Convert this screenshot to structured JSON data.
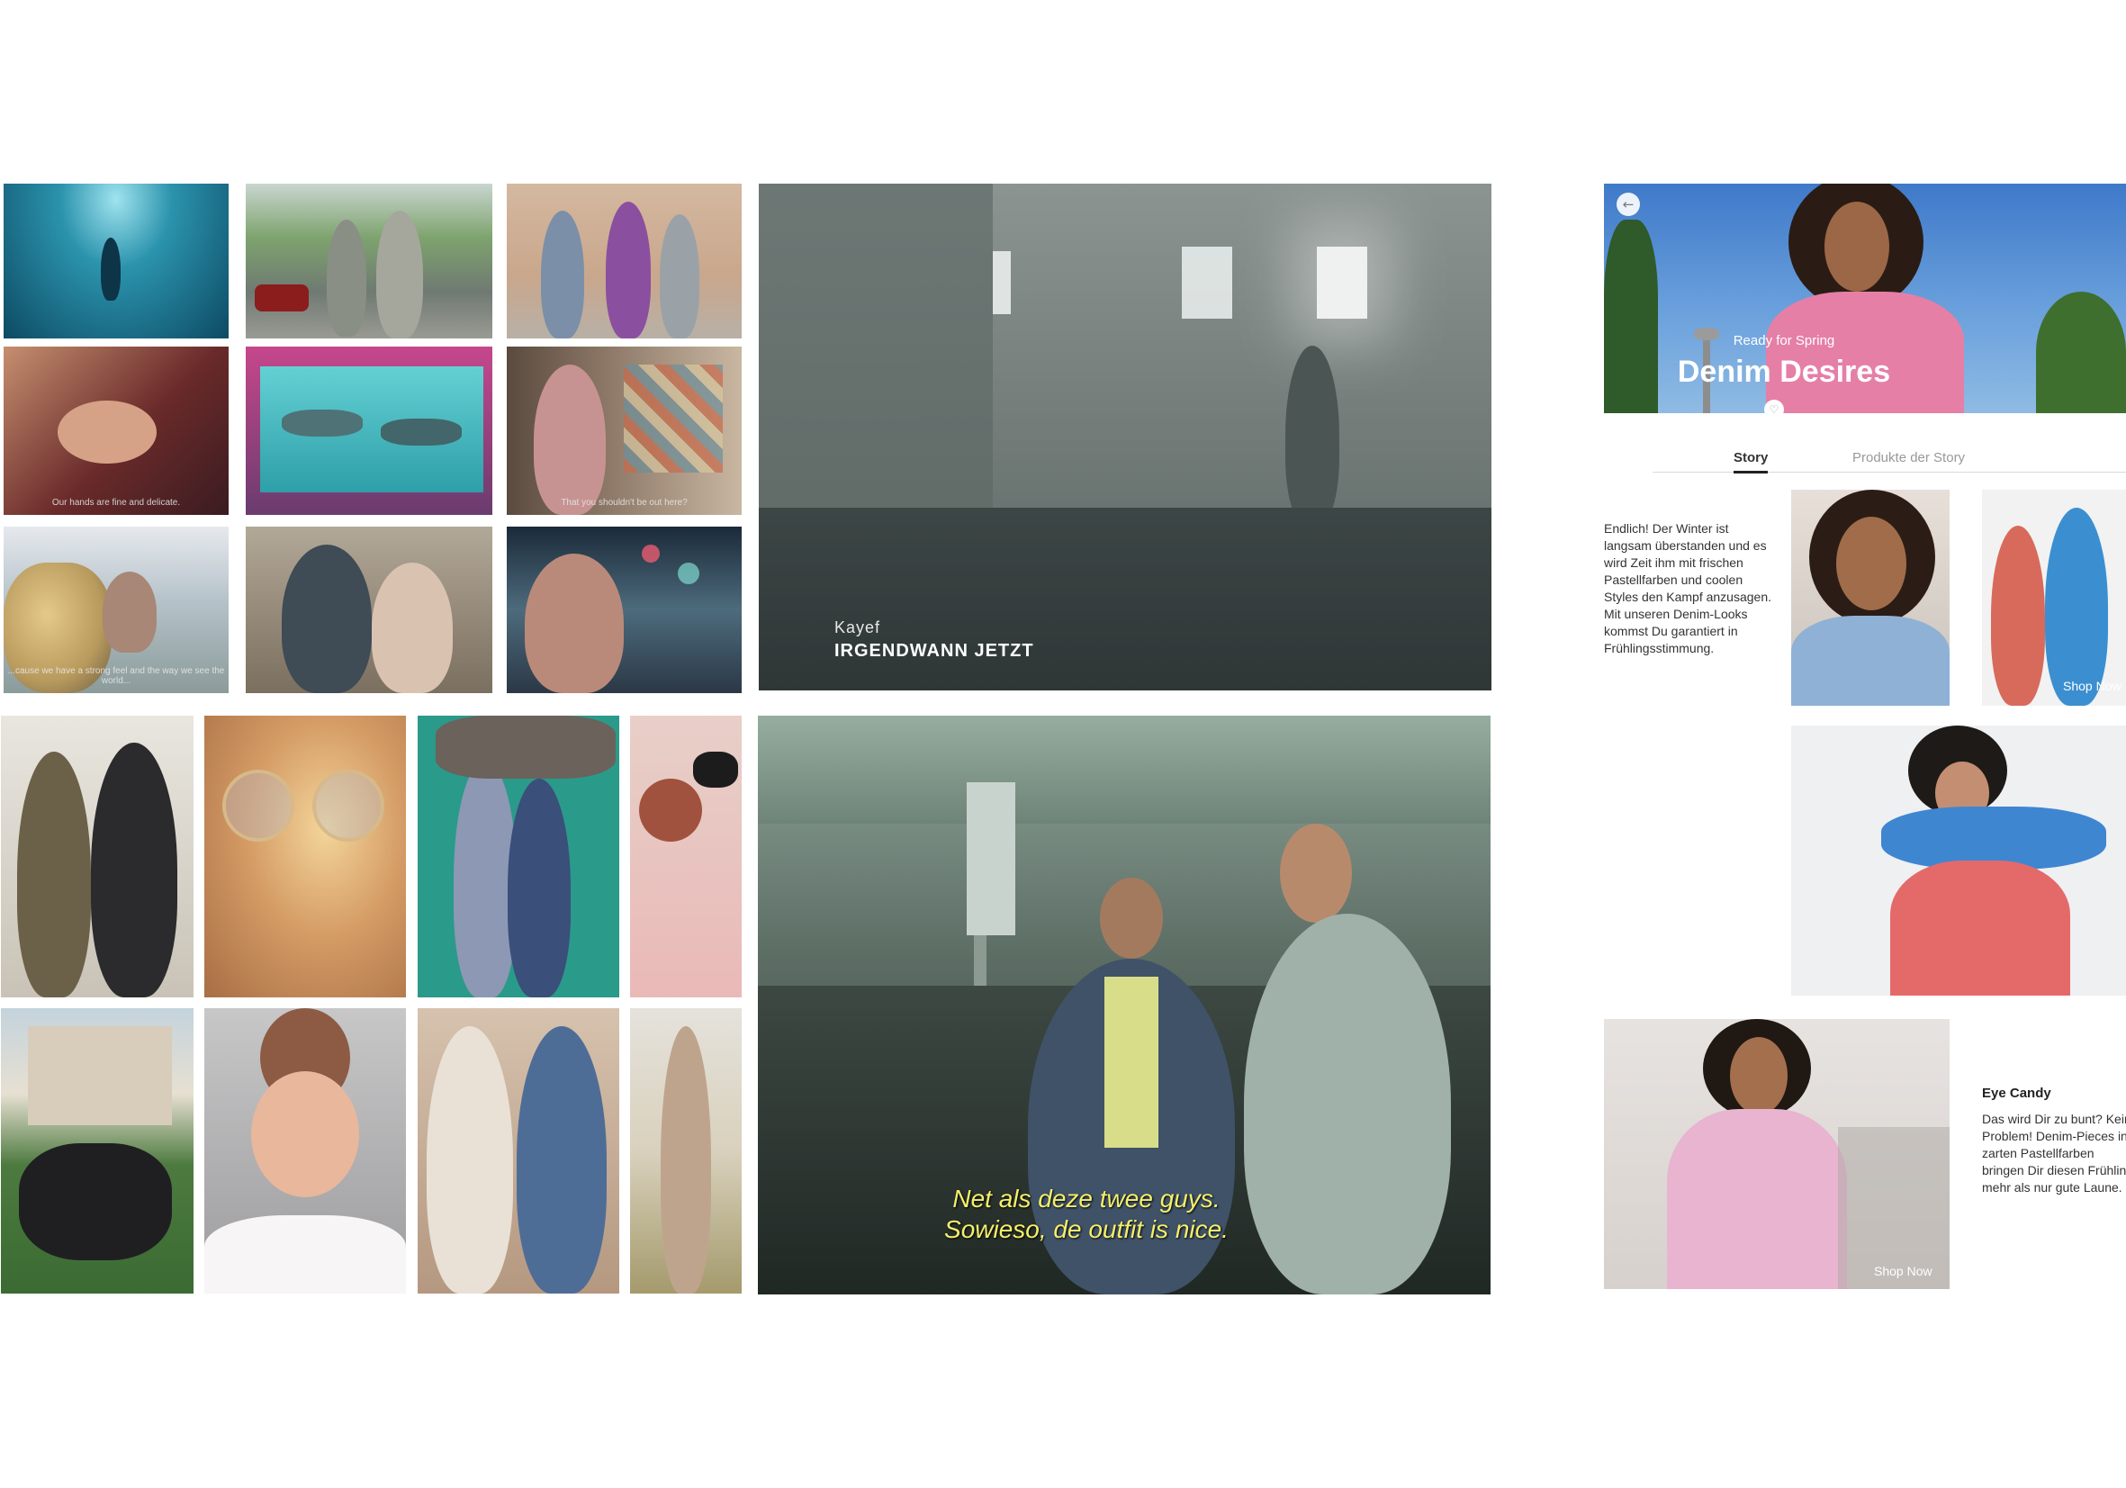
{
  "video_left": {
    "artist": "Kayef",
    "title": "IRGENDWANN JETZT"
  },
  "video_right": {
    "subtitle_line1": "Net als deze twee guys.",
    "subtitle_line2": "Sowieso, de outfit is nice."
  },
  "moodboard": {
    "captions": [
      "Our hands are fine and delicate.",
      "That you shouldn't be out here?",
      "...cause we have a strong feel and the way we see the world..."
    ]
  },
  "phone": {
    "back_icon": "arrow-left-icon",
    "hero_subtitle": "Ready for Spring",
    "hero_title": "Denim Desires",
    "heart_icon": "heart-icon",
    "tabs": [
      "Story",
      "Produkte der Story"
    ],
    "story_text": "Endlich! Der Winter ist langsam überstanden und es wird Zeit ihm mit frischen Pastellfarben und coolen Styles den Kampf anzusagen. Mit unseren Denim-Looks kommst Du garantiert in Frühlingsstimmung.",
    "shop_now_1": "Shop Now",
    "shop_now_2": "Shop Now",
    "eye_candy_title": "Eye Candy",
    "eye_candy_text": "Das wird Dir zu bunt? Kein Problem! Denim-Pieces in zarten Pastellfarben bringen Dir diesen Frühling mehr als nur gute Laune."
  }
}
